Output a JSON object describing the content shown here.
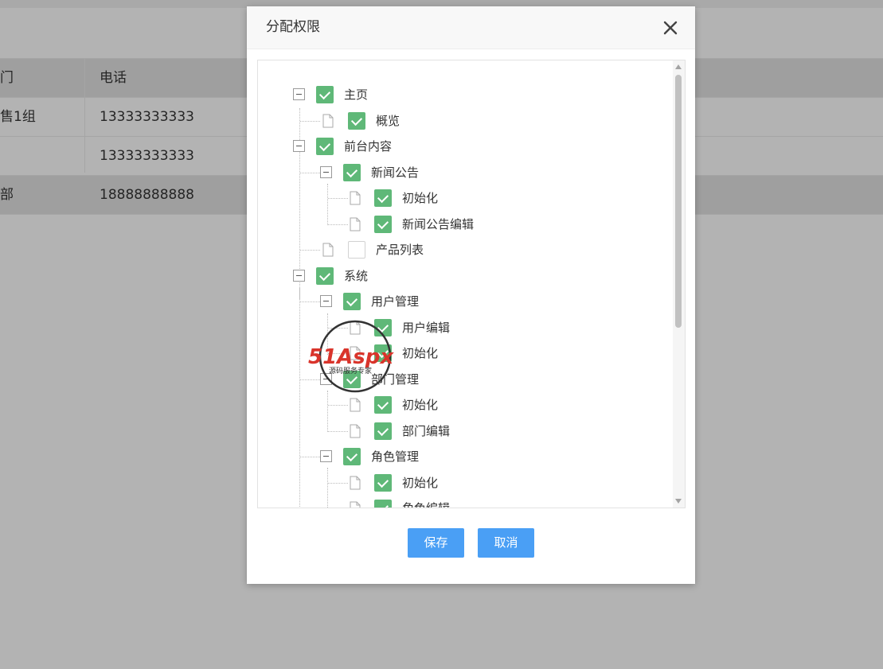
{
  "background_table": {
    "headers": [
      "门",
      "电话"
    ],
    "rows": [
      [
        "售1组",
        "13333333333"
      ],
      [
        "",
        "13333333333"
      ],
      [
        "部",
        "18888888888"
      ]
    ]
  },
  "dialog": {
    "title": "分配权限",
    "save_label": "保存",
    "cancel_label": "取消"
  },
  "tree": [
    {
      "label": "主页",
      "checked": true
    },
    {
      "label": "概览",
      "checked": true
    },
    {
      "label": "前台内容",
      "checked": true
    },
    {
      "label": "新闻公告",
      "checked": true
    },
    {
      "label": "初始化",
      "checked": true
    },
    {
      "label": "新闻公告编辑",
      "checked": true
    },
    {
      "label": "产品列表",
      "checked": false
    },
    {
      "label": "系统",
      "checked": true
    },
    {
      "label": "用户管理",
      "checked": true
    },
    {
      "label": "用户编辑",
      "checked": true
    },
    {
      "label": "初始化",
      "checked": true
    },
    {
      "label": "部门管理",
      "checked": true
    },
    {
      "label": "初始化",
      "checked": true
    },
    {
      "label": "部门编辑",
      "checked": true
    },
    {
      "label": "角色管理",
      "checked": true
    },
    {
      "label": "初始化",
      "checked": true
    },
    {
      "label": "角色编辑",
      "checked": true
    }
  ],
  "watermark": {
    "brand": "51Aspx",
    "tagline": "源码服务专家"
  }
}
